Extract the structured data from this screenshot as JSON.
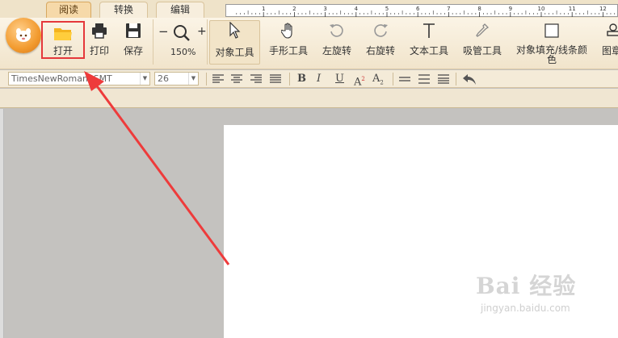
{
  "tabs": [
    {
      "label": "阅读",
      "active": true
    },
    {
      "label": "转换",
      "active": false
    },
    {
      "label": "编辑",
      "active": false
    }
  ],
  "ribbon": {
    "open": "打开",
    "print": "打印",
    "save": "保存",
    "zoom_minus": "−",
    "zoom_plus": "+",
    "zoom_level": "150%",
    "object_tool": "对象工具",
    "hand_tool": "手形工具",
    "rotate_left": "左旋转",
    "rotate_right": "右旋转",
    "text_tool": "文本工具",
    "eyedropper_tool": "吸管工具",
    "fill_line_color_1": "对象填充/线条颜",
    "fill_line_color_2": "色",
    "image_partial": "图章"
  },
  "format": {
    "font_name": "TimesNewRomanPSMT",
    "font_size": "26",
    "bold": "B",
    "italic": "I",
    "underline": "U",
    "superscript": "A",
    "subscript": "A"
  },
  "ruler": {
    "labels": [
      "1",
      "2",
      "3",
      "4",
      "5",
      "6",
      "7",
      "8",
      "9",
      "10",
      "11",
      "12"
    ]
  },
  "watermark": {
    "logo": "Bai 经验",
    "url": "jingyan.baidu.com"
  },
  "colors": {
    "highlight": "#e5383b",
    "accent": "#f29a2e"
  }
}
